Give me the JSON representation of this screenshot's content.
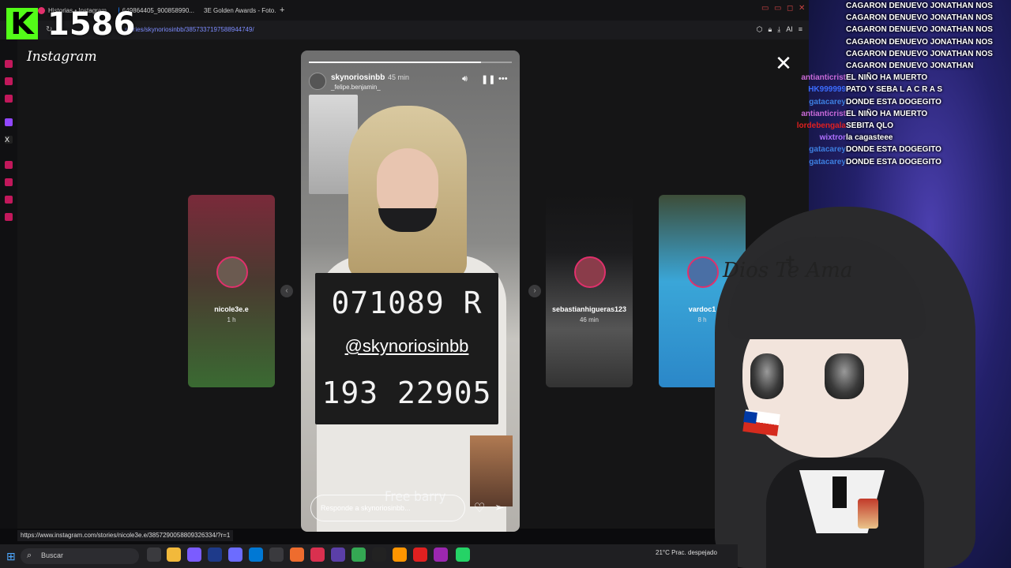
{
  "stream": {
    "viewer_count": "1586",
    "kick_letter": "K"
  },
  "browser": {
    "tabs": [
      {
        "label": "Historias • Instagram"
      },
      {
        "label": "649864405_900858990..."
      },
      {
        "label": "3E Golden Awards - Foto..."
      }
    ],
    "new_tab": "+",
    "url": "stories/skynoriosinbb/3857337197588944749/",
    "ai_label": "AI"
  },
  "instagram": {
    "logo": "Instagram",
    "close": "✕",
    "main_story": {
      "username": "skynoriosinbb",
      "time": "45 min",
      "music": "_felipe.benjamin_",
      "progress": 0.85,
      "board_line1": "071089 R",
      "board_handle": "@skynoriosinbb",
      "board_line2": "193 22905",
      "caption": "Free barry",
      "reply_placeholder": "Responde a skynoriosinbb..."
    },
    "previews": [
      {
        "username": "nicole3e.e",
        "time": "1 h"
      },
      {
        "username": "sebastianhigueras123",
        "time": "46 min"
      },
      {
        "username": "vardoc1",
        "time": "8 h"
      }
    ]
  },
  "status_link": "https://www.instagram.com/stories/nicole3e.e/3857290058809326334/?r=1",
  "taskbar": {
    "search_placeholder": "Buscar",
    "weather": "21°C  Prac. despejado"
  },
  "chat": [
    {
      "user": "",
      "color": "#ffffff",
      "message": "CAGARON DENUEVO JONATHAN NOS"
    },
    {
      "user": "",
      "color": "#ffffff",
      "message": "CAGARON DENUEVO JONATHAN NOS"
    },
    {
      "user": "",
      "color": "#ffffff",
      "message": "CAGARON DENUEVO JONATHAN NOS"
    },
    {
      "user": "",
      "color": "#ffffff",
      "message": "CAGARON DENUEVO JONATHAN NOS"
    },
    {
      "user": "",
      "color": "#ffffff",
      "message": "CAGARON DENUEVO JONATHAN NOS"
    },
    {
      "user": "",
      "color": "#ffffff",
      "message": "CAGARON DENUEVO JONATHAN"
    },
    {
      "user": "antianticrist",
      "color": "#c86ad8",
      "message": "EL NIÑO HA MUERTO"
    },
    {
      "user": "HK999999",
      "color": "#3b6cff",
      "message": "PATO Y SEBA L A C R A S"
    },
    {
      "user": "gatacarey",
      "color": "#3d7fe0",
      "message": "DONDE ESTA DOGEGITO"
    },
    {
      "user": "antianticrist",
      "color": "#c86ad8",
      "message": "EL NIÑO HA MUERTO"
    },
    {
      "user": "lordebengala",
      "color": "#e02020",
      "message": "SEBITA QLO"
    },
    {
      "user": "wixtror",
      "color": "#b070ff",
      "message": "la cagasteee"
    },
    {
      "user": "gatacarey",
      "color": "#3d7fe0",
      "message": "DONDE ESTA DOGEGITO"
    },
    {
      "user": "gatacarey",
      "color": "#3d7fe0",
      "message": "DONDE ESTA DOGEGITO"
    }
  ],
  "avatar_text": "Dios Te Ama"
}
